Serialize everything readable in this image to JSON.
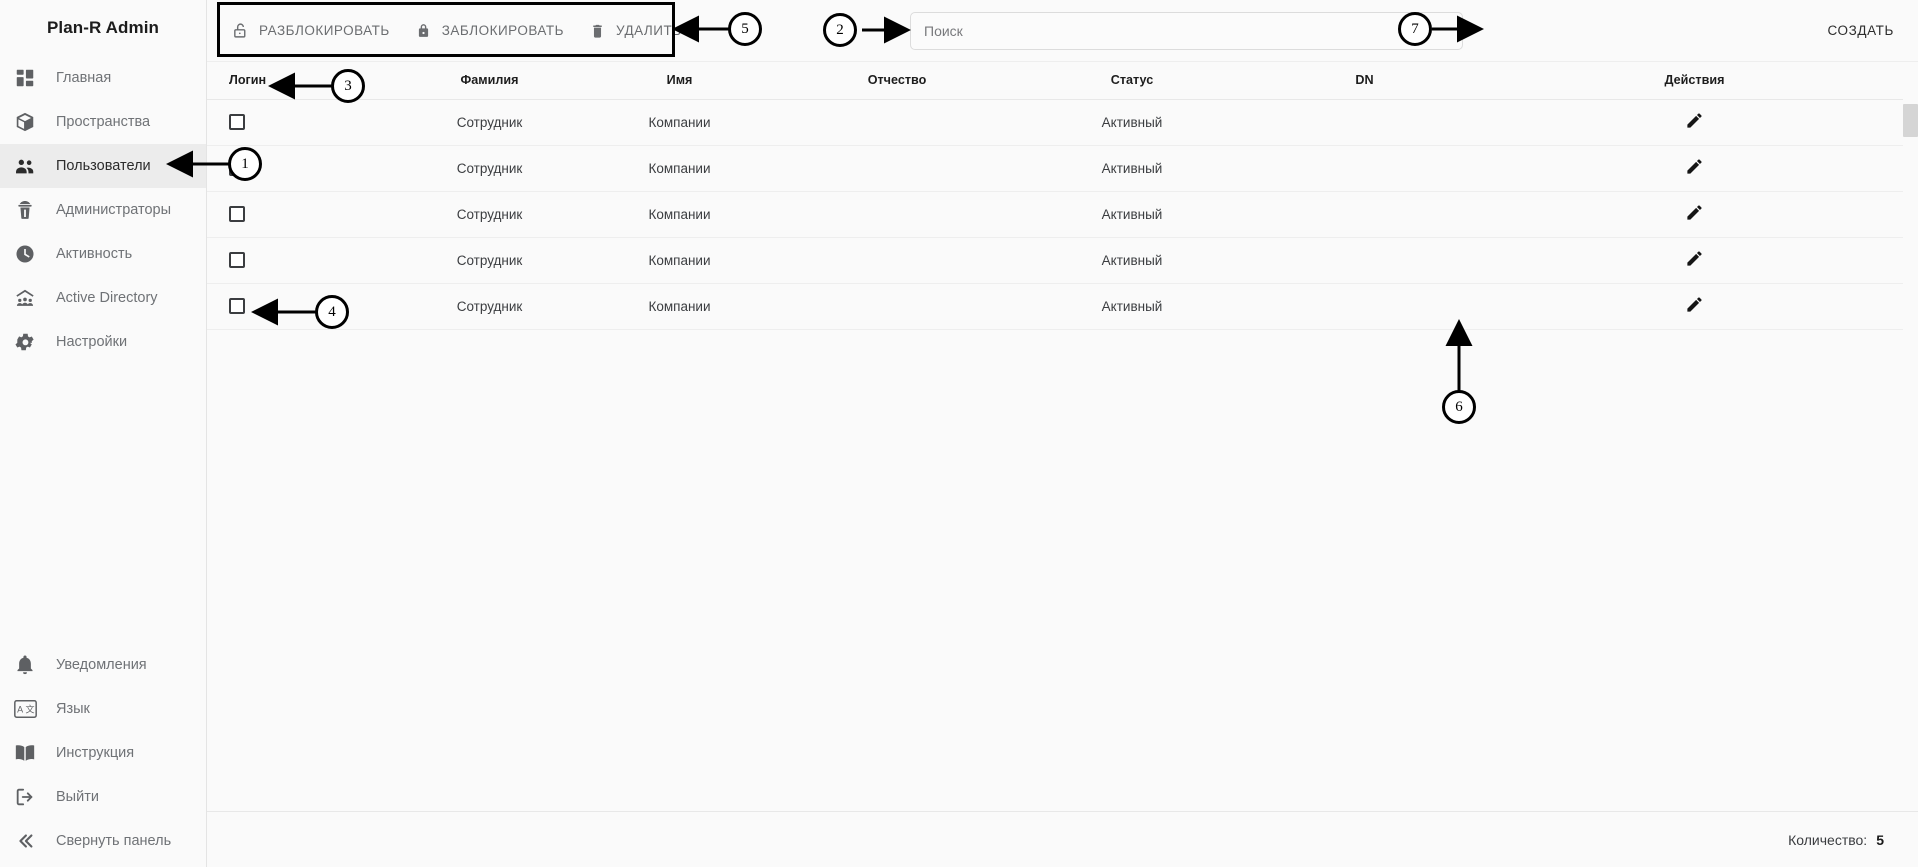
{
  "sidebar": {
    "brand": "Plan-R Admin",
    "top_items": [
      {
        "label": "Главная",
        "icon": "dashboard-icon",
        "active": false
      },
      {
        "label": "Пространства",
        "icon": "cube-icon",
        "active": false
      },
      {
        "label": "Пользователи",
        "icon": "users-icon",
        "active": true
      },
      {
        "label": "Администраторы",
        "icon": "admin-icon",
        "active": false
      },
      {
        "label": "Активность",
        "icon": "clock-icon",
        "active": false
      },
      {
        "label": "Active Directory",
        "icon": "directory-icon",
        "active": false
      },
      {
        "label": "Настройки",
        "icon": "gear-icon",
        "active": false
      }
    ],
    "bottom_items": [
      {
        "label": "Уведомления",
        "icon": "bell-icon"
      },
      {
        "label": "Язык",
        "icon": "translate-icon"
      },
      {
        "label": "Инструкция",
        "icon": "book-icon"
      },
      {
        "label": "Выйти",
        "icon": "logout-icon"
      },
      {
        "label": "Свернуть панель",
        "icon": "collapse-icon"
      }
    ]
  },
  "toolbar": {
    "unlock_label": "РАЗБЛОКИРОВАТЬ",
    "lock_label": "ЗАБЛОКИРОВАТЬ",
    "delete_label": "УДАЛИТЬ",
    "create_label": "СОЗДАТЬ",
    "unlock_icon": "unlock-icon",
    "lock_icon": "lock-icon",
    "delete_icon": "trash-icon"
  },
  "search": {
    "placeholder": "Поиск",
    "value": ""
  },
  "table": {
    "columns": [
      "Логин",
      "Фамилия",
      "Имя",
      "Отчество",
      "Статус",
      "DN",
      "Действия"
    ],
    "rows": [
      {
        "login": "",
        "familiya": "Сотрудник",
        "imya": "Компании",
        "otchestvo": "",
        "status": "Активный",
        "dn": "",
        "checked": false
      },
      {
        "login": "",
        "familiya": "Сотрудник",
        "imya": "Компании",
        "otchestvo": "",
        "status": "Активный",
        "dn": "",
        "checked": false
      },
      {
        "login": "",
        "familiya": "Сотрудник",
        "imya": "Компании",
        "otchestvo": "",
        "status": "Активный",
        "dn": "",
        "checked": false
      },
      {
        "login": "",
        "familiya": "Сотрудник",
        "imya": "Компании",
        "otchestvo": "",
        "status": "Активный",
        "dn": "",
        "checked": false
      },
      {
        "login": "",
        "familiya": "Сотрудник",
        "imya": "Компании",
        "otchestvo": "",
        "status": "Активный",
        "dn": "",
        "checked": false
      }
    ]
  },
  "footer": {
    "count_label": "Количество:",
    "count_value": "5"
  },
  "annotations": [
    {
      "id": "1",
      "number": "1"
    },
    {
      "id": "2",
      "number": "2"
    },
    {
      "id": "3",
      "number": "3"
    },
    {
      "id": "4",
      "number": "4"
    },
    {
      "id": "5",
      "number": "5"
    },
    {
      "id": "6",
      "number": "6"
    },
    {
      "id": "7",
      "number": "7"
    }
  ],
  "colors": {
    "page_bg": "#fafafa",
    "sidebar_active_bg": "#ececec",
    "annotation": "#000000",
    "muted_text": "#6f7276"
  }
}
